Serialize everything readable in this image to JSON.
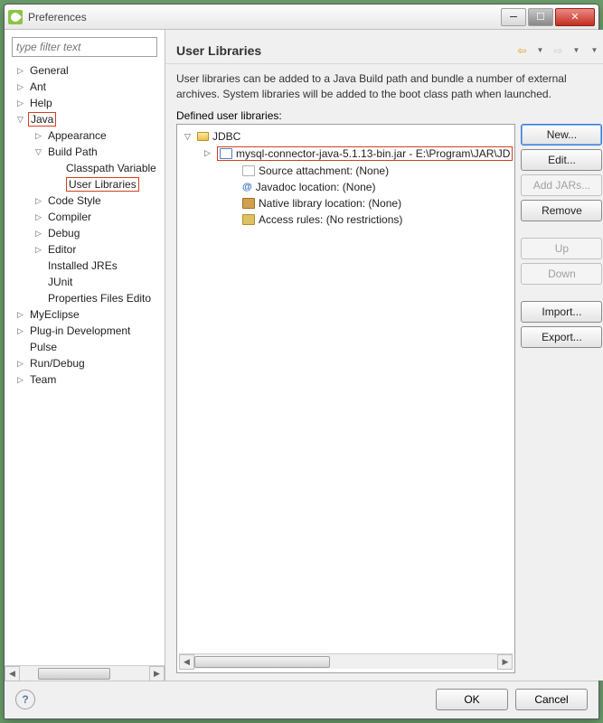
{
  "window": {
    "title": "Preferences"
  },
  "sidebar": {
    "filter_placeholder": "type filter text",
    "items": [
      {
        "label": "General",
        "depth": 0,
        "exp": "▷"
      },
      {
        "label": "Ant",
        "depth": 0,
        "exp": "▷"
      },
      {
        "label": "Help",
        "depth": 0,
        "exp": "▷"
      },
      {
        "label": "Java",
        "depth": 0,
        "exp": "▽",
        "highlight": true
      },
      {
        "label": "Appearance",
        "depth": 1,
        "exp": "▷"
      },
      {
        "label": "Build Path",
        "depth": 1,
        "exp": "▽"
      },
      {
        "label": "Classpath Variable",
        "depth": 2
      },
      {
        "label": "User Libraries",
        "depth": 3,
        "highlight": true
      },
      {
        "label": "Code Style",
        "depth": 1,
        "exp": "▷"
      },
      {
        "label": "Compiler",
        "depth": 1,
        "exp": "▷"
      },
      {
        "label": "Debug",
        "depth": 1,
        "exp": "▷"
      },
      {
        "label": "Editor",
        "depth": 1,
        "exp": "▷"
      },
      {
        "label": "Installed JREs",
        "depth": 1
      },
      {
        "label": "JUnit",
        "depth": 1
      },
      {
        "label": "Properties Files Edito",
        "depth": 1
      },
      {
        "label": "MyEclipse",
        "depth": 0,
        "exp": "▷"
      },
      {
        "label": "Plug-in Development",
        "depth": 0,
        "exp": "▷"
      },
      {
        "label": "Pulse",
        "depth": 0
      },
      {
        "label": "Run/Debug",
        "depth": 0,
        "exp": "▷"
      },
      {
        "label": "Team",
        "depth": 0,
        "exp": "▷"
      }
    ]
  },
  "main": {
    "heading": "User Libraries",
    "description": "User libraries can be added to a Java Build path and bundle a number of external archives. System libraries will be added to the boot class path when launched.",
    "defined_label": "Defined user libraries:",
    "tree": [
      {
        "label": "JDBC",
        "depth": 0,
        "icon": "folder",
        "exp": "▽"
      },
      {
        "label": "mysql-connector-java-5.1.13-bin.jar - E:\\Program\\JAR\\JD",
        "depth": 1,
        "icon": "jar",
        "exp": "▷",
        "highlight": true
      },
      {
        "label": "Source attachment: (None)",
        "depth": 2,
        "icon": "doc"
      },
      {
        "label": "Javadoc location: (None)",
        "depth": 2,
        "icon": "at"
      },
      {
        "label": "Native library location: (None)",
        "depth": 2,
        "icon": "native"
      },
      {
        "label": "Access rules: (No restrictions)",
        "depth": 2,
        "icon": "access"
      }
    ],
    "buttons": {
      "new": "New...",
      "edit": "Edit...",
      "add_jars": "Add JARs...",
      "remove": "Remove",
      "up": "Up",
      "down": "Down",
      "import": "Import...",
      "export": "Export..."
    }
  },
  "footer": {
    "ok": "OK",
    "cancel": "Cancel"
  }
}
